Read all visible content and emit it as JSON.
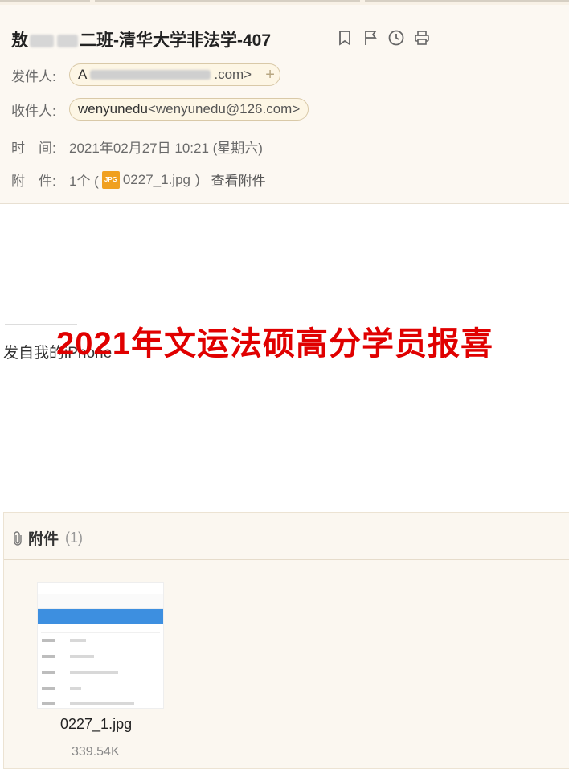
{
  "header": {
    "subject": {
      "prefix": "敖",
      "middle": "二班-清华大学非法学-407"
    },
    "from": {
      "label": "发件人:",
      "name_start": "A",
      "addr_end": ".com>"
    },
    "to": {
      "label": "收件人:",
      "name": "wenyunedu",
      "address": "<wenyunedu@126.com>"
    },
    "time": {
      "label": "时　间:",
      "value": "2021年02月27日 10:21 (星期六)"
    },
    "attachment": {
      "label": "附　件:",
      "count_text": "1个 (",
      "icon_text": "JPG",
      "filename": "0227_1.jpg",
      "close_paren": ")",
      "view_label": "查看附件"
    }
  },
  "body": {
    "signature": "发自我的iPhone",
    "banner": "2021年文运法硕高分学员报喜"
  },
  "attachments_panel": {
    "title": "附件",
    "count": "(1)",
    "file": {
      "name": "0227_1.jpg",
      "size": "339.54K"
    }
  },
  "colors": {
    "banner": "#e00000",
    "header_bg": "#fcf8f2",
    "pill_border": "#d9c9a8",
    "thumbnail_blue": "#3d8fe0"
  },
  "icons": [
    "bookmark-icon",
    "flag-icon",
    "clock-icon",
    "print-icon",
    "add-contact-icon",
    "jpg-file-icon",
    "paperclip-icon"
  ]
}
